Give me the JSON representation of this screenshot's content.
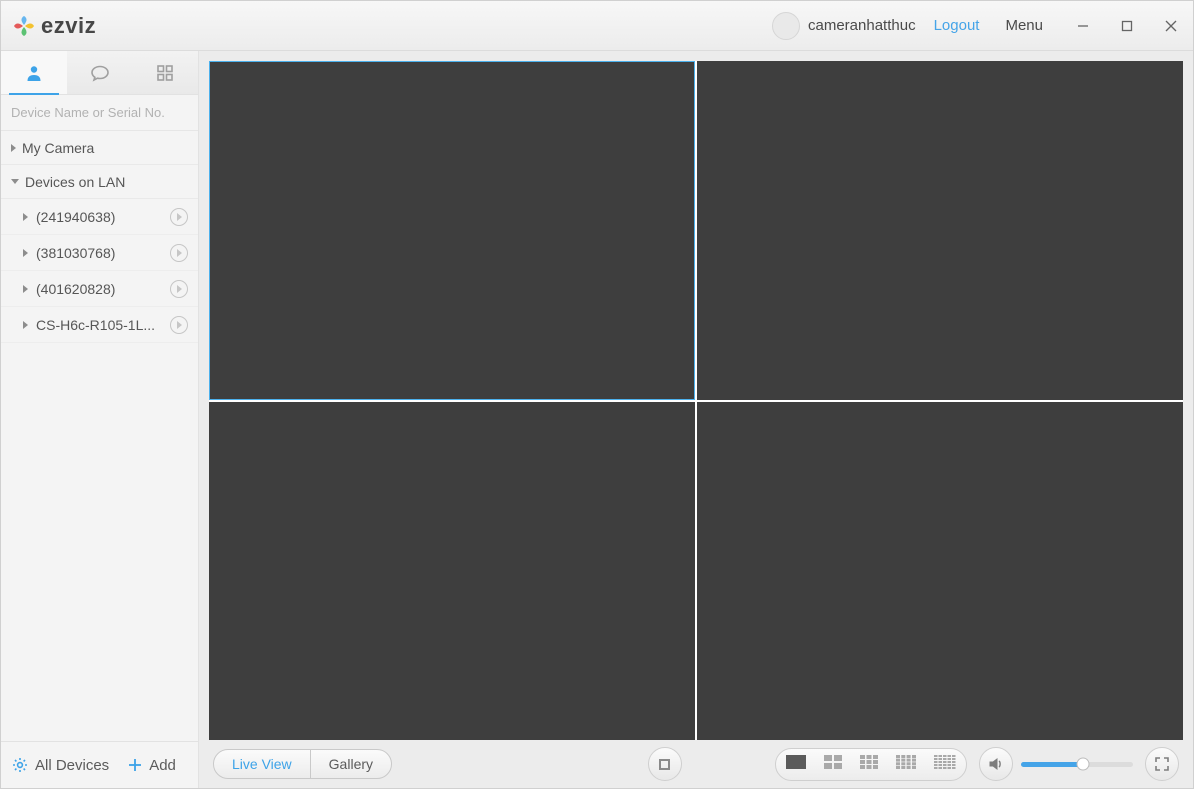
{
  "brand": {
    "name": "ezviz"
  },
  "titlebar": {
    "username": "cameranhatthuc",
    "logout": "Logout",
    "menu": "Menu"
  },
  "sidebar": {
    "search_placeholder": "Device Name or Serial No.",
    "groups": [
      {
        "label": "My Camera",
        "expanded": false
      },
      {
        "label": "Devices on LAN",
        "expanded": true,
        "items": [
          {
            "label": "(241940638)"
          },
          {
            "label": "(381030768)"
          },
          {
            "label": "(401620828)"
          },
          {
            "label": "CS-H6c-R105-1L..."
          }
        ]
      }
    ],
    "bottom": {
      "all": "All Devices",
      "add": "Add"
    }
  },
  "bottomBar": {
    "tabs": {
      "live": "Live View",
      "gallery": "Gallery",
      "active": "live"
    },
    "volume_percent": 55
  },
  "grid": {
    "rows": 2,
    "cols": 2,
    "selected": 0
  }
}
